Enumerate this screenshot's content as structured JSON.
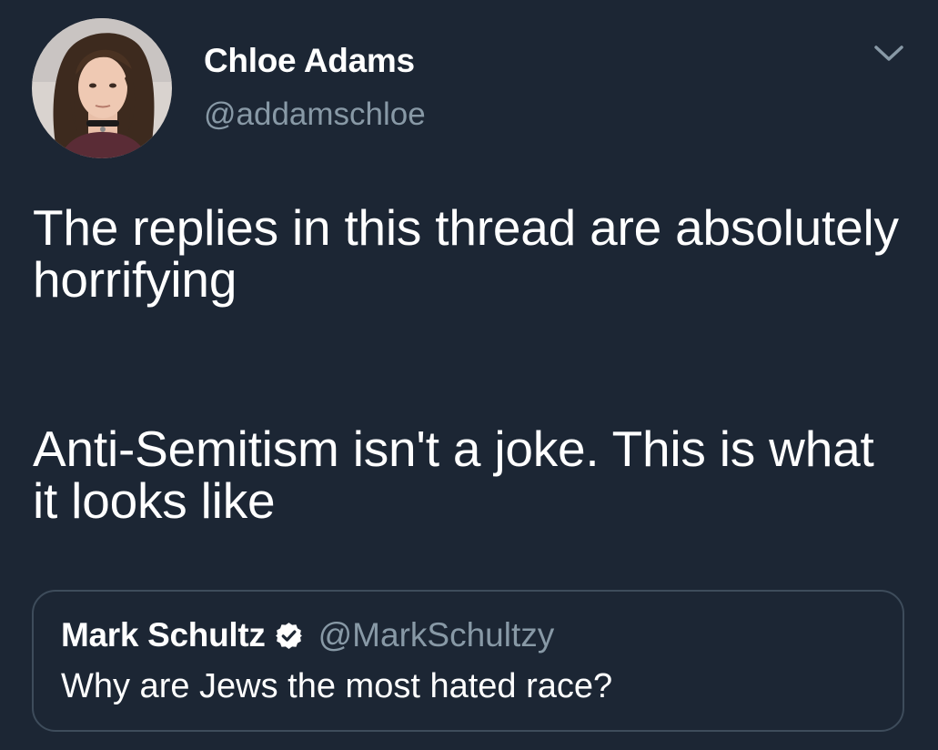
{
  "author": {
    "display_name": "Chloe Adams",
    "handle": "@addamschloe",
    "avatar_icon": "profile-photo"
  },
  "menu": {
    "icon": "chevron-down-icon"
  },
  "tweet": {
    "paragraphs": [
      "The replies in this thread are absolutely horrifying",
      "Anti-Semitism isn't a joke. This is what it looks like"
    ]
  },
  "quoted_tweet": {
    "display_name": "Mark Schultz",
    "verified_icon": "verified-badge-icon",
    "handle": "@MarkSchultzy",
    "text": "Why are Jews the most hated race?"
  },
  "colors": {
    "background": "#1c2634",
    "primary_text": "#ffffff",
    "secondary_text": "#8899a6",
    "border": "#3e4c5b"
  }
}
